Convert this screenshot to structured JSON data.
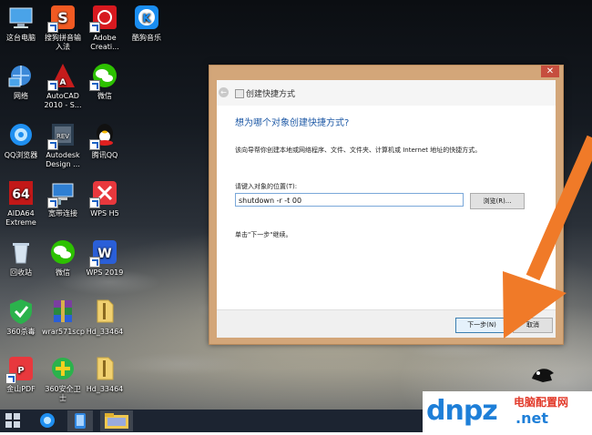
{
  "desktop_icons": [
    {
      "label": "这台电脑",
      "icon": "computer-icon"
    },
    {
      "label": "搜狗拼音输入法",
      "icon": "sogou-icon"
    },
    {
      "label": "Adobe Creati...",
      "icon": "adobe-cc-icon"
    },
    {
      "label": "酷狗音乐",
      "icon": "kugou-icon"
    },
    {
      "label": "网络",
      "icon": "network-icon"
    },
    {
      "label": "AutoCAD 2010 - S...",
      "icon": "autocad-icon"
    },
    {
      "label": "微信",
      "icon": "wechat-icon"
    },
    {
      "label": "QQ浏览器",
      "icon": "qq-browser-icon"
    },
    {
      "label": "Autodesk Design ...",
      "icon": "autodesk-revit-icon"
    },
    {
      "label": "腾讯QQ",
      "icon": "qq-icon"
    },
    {
      "label": "AIDA64 Extreme",
      "icon": "aida64-icon"
    },
    {
      "label": "宽带连接",
      "icon": "broadband-icon"
    },
    {
      "label": "WPS H5",
      "icon": "wps-h5-icon"
    },
    {
      "label": "回收站",
      "icon": "recycle-bin-icon"
    },
    {
      "label": "微信",
      "icon": "wechat-icon"
    },
    {
      "label": "WPS 2019",
      "icon": "wps-icon"
    },
    {
      "label": "360杀毒",
      "icon": "360-antivirus-icon"
    },
    {
      "label": "wrar571scp",
      "icon": "winrar-icon"
    },
    {
      "label": "Hd_33464",
      "icon": "file-icon"
    },
    {
      "label": "金山PDF",
      "icon": "kingsoft-pdf-icon"
    },
    {
      "label": "360安全卫士",
      "icon": "360-security-icon"
    },
    {
      "label": "Hd_33464",
      "icon": "file-icon"
    }
  ],
  "dialog": {
    "window_title": "创建快捷方式",
    "heading": "想为哪个对象创建快捷方式?",
    "description": "该向导帮你创建本地或网络程序、文件、文件夹、计算机或 Internet 地址的快捷方式。",
    "location_label": "请键入对象的位置(T):",
    "location_value": "shutdown -r -t 00",
    "browse_label": "浏览(R)...",
    "hint": "单击\"下一步\"继续。",
    "next_label": "下一步(N)",
    "cancel_label": "取消",
    "close_glyph": "✕"
  },
  "watermark": {
    "logo": "dnpz",
    "tag": "电脑配置网",
    "url": ".net"
  },
  "colors": {
    "dialog_frame": "#d3a679",
    "arrow": "#f07a28",
    "heading": "#1f5aa6"
  }
}
